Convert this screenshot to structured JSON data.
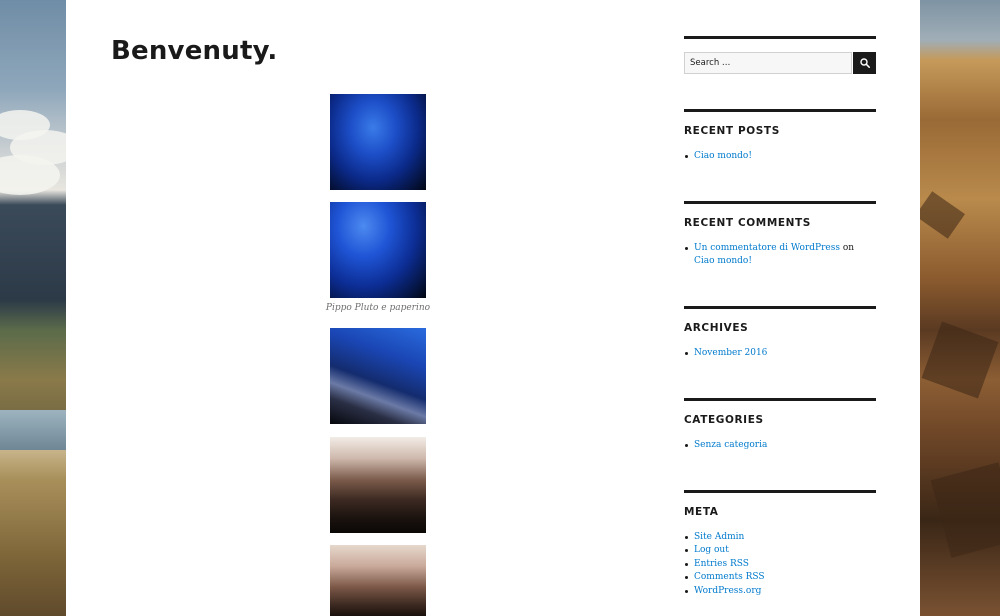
{
  "page": {
    "title": "Benvenuty."
  },
  "gallery": {
    "caption": "Pippo Pluto e paperino"
  },
  "search": {
    "placeholder": "Search …"
  },
  "widgets": {
    "recent_posts": {
      "title": "RECENT POSTS",
      "items": [
        "Ciao mondo!"
      ]
    },
    "recent_comments": {
      "title": "RECENT COMMENTS",
      "author": "Un commentatore di WordPress",
      "on": "on",
      "post": "Ciao mondo!"
    },
    "archives": {
      "title": "ARCHIVES",
      "items": [
        "November 2016"
      ]
    },
    "categories": {
      "title": "CATEGORIES",
      "items": [
        "Senza categoria"
      ]
    },
    "meta": {
      "title": "META",
      "items": [
        "Site Admin",
        "Log out",
        "Entries RSS",
        "Comments RSS",
        "WordPress.org"
      ]
    }
  },
  "colors": {
    "link": "#007acc",
    "text": "#1a1a1a",
    "caption": "#6e6e6e",
    "search_button": "#1a1a1a"
  },
  "icons": {
    "search": "search-icon"
  }
}
